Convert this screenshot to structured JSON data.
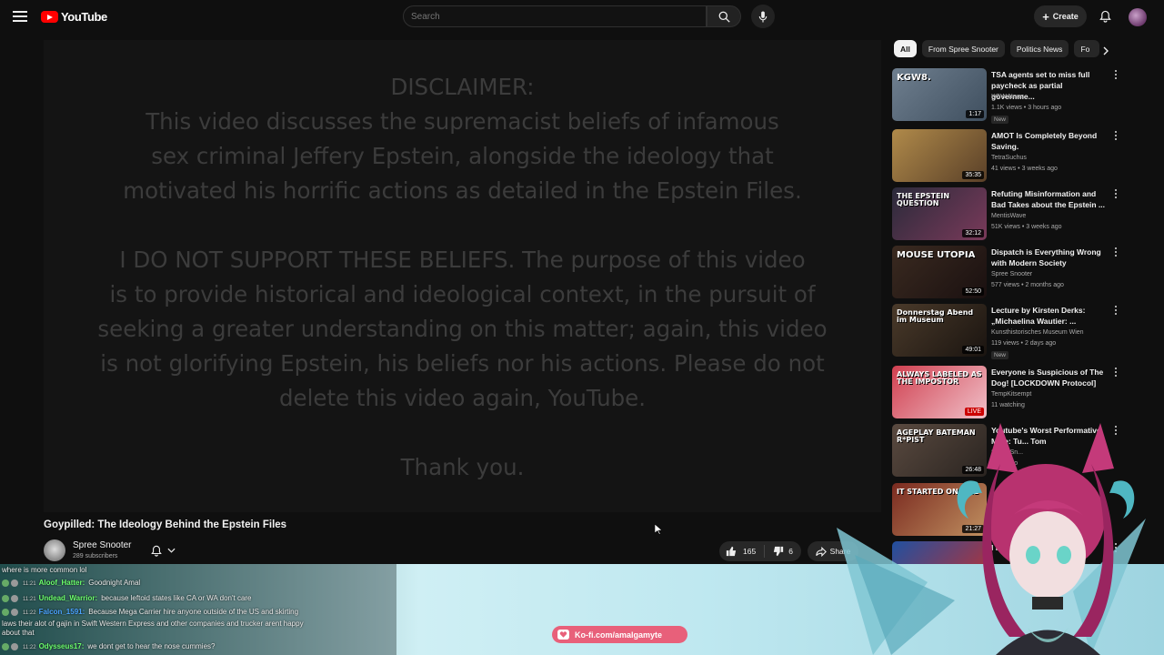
{
  "header": {
    "logo_text": "YouTube",
    "search_placeholder": "Search",
    "create_label": "Create"
  },
  "player": {
    "disclaimer_title": "DISCLAIMER:",
    "paragraph1": "This video discusses the supremacist beliefs of infamous\nsex criminal Jeffery Epstein, alongside the ideology that\nmotivated his horrific actions as detailed in the Epstein Files.",
    "paragraph2": "I DO NOT SUPPORT THESE BELIEFS. The purpose of this video\nis to provide historical and ideological context, in the pursuit of\nseeking a greater understanding on this matter; again, this video\nis not glorifying Epstein, his beliefs nor his actions. Please do not\ndelete this video again, YouTube.",
    "thanks": "Thank you."
  },
  "video": {
    "title": "Goypilled: The Ideology Behind the Epstein Files",
    "channel": "Spree Snooter",
    "subscribers": "289 subscribers",
    "likes": "165",
    "dislikes": "6",
    "share_label": "Share"
  },
  "chips": [
    "All",
    "From Spree Snooter",
    "Politics News",
    "Fo"
  ],
  "recommended": [
    {
      "title": "TSA agents set to miss full paycheck as partial governme...",
      "channel": "KGW News",
      "meta": "1.1K views • 3 hours ago",
      "duration": "1:17",
      "badge": "New",
      "thumb_text": "KGW8.",
      "colors": [
        "#6f7f8f",
        "#3f4f5f"
      ]
    },
    {
      "title": "AMOT Is Completely Beyond Saving.",
      "channel": "TetraSuchus",
      "meta": "41 views • 3 weeks ago",
      "duration": "35:35",
      "badge": "",
      "thumb_text": "",
      "colors": [
        "#b08a4a",
        "#5a4028"
      ]
    },
    {
      "title": "Refuting Misinformation and Bad Takes about the Epstein ...",
      "channel": "MentisWave",
      "meta": "51K views • 3 weeks ago",
      "duration": "32:12",
      "badge": "",
      "thumb_text": "THE EPSTEIN QUESTION",
      "colors": [
        "#2a2a3a",
        "#7a3a5a"
      ]
    },
    {
      "title": "Dispatch is Everything Wrong with Modern Society",
      "channel": "Spree Snooter",
      "meta": "577 views • 2 months ago",
      "duration": "52:50",
      "badge": "",
      "thumb_text": "MOUSE UTOPIA",
      "colors": [
        "#3a2a20",
        "#1a1010"
      ]
    },
    {
      "title": "Lecture by Kirsten Derks: „Michaelina Wautier: ...",
      "channel": "Kunsthistorisches Museum Wien",
      "meta": "119 views • 2 days ago",
      "duration": "49:01",
      "badge": "New",
      "thumb_text": "Donnerstag Abend im Museum",
      "colors": [
        "#4a3a2a",
        "#1a1410"
      ]
    },
    {
      "title": "Everyone is Suspicious of The Dog! [LOCKDOWN Protocol]",
      "channel": "TempKitsempt",
      "meta": "11 watching",
      "duration": "LIVE",
      "badge": "",
      "thumb_text": "ALWAYS LABELED AS THE IMPOSTOR",
      "colors": [
        "#d04050",
        "#f0c0c8"
      ]
    },
    {
      "title": "Youtube's Worst Performative Male: Tu... Tom",
      "channel": "Spree Sn...",
      "meta": "...nth ago",
      "duration": "26:48",
      "badge": "",
      "thumb_text": "AGEPLAY BATEMAN R*PIST",
      "colors": [
        "#5a4a40",
        "#2a2420"
      ]
    },
    {
      "title": "",
      "channel": "",
      "meta": "",
      "duration": "21:27",
      "badge": "",
      "thumb_text": "IT STARTED ON 9/11",
      "colors": [
        "#7a2a20",
        "#c09060"
      ]
    },
    {
      "title": "I Inve... Lady...",
      "channel": "",
      "meta": "",
      "duration": "",
      "badge": "",
      "thumb_text": "",
      "colors": [
        "#2050a0",
        "#c03030"
      ]
    }
  ],
  "chat": {
    "top_line": "where is more common lol",
    "messages": [
      {
        "time": "11:21",
        "user": "Aloof_Hatter:",
        "text": "Goodnight Amal"
      },
      {
        "time": "11:21",
        "user": "Undead_Warrior:",
        "text": "because leftoid states like CA or WA don't care"
      },
      {
        "time": "11:22",
        "user": "Falcon_1591:",
        "text": "Because Mega Carrier hire anyone outside of the US and skirting"
      },
      {
        "time": "",
        "user": "",
        "text": "laws their alot of gajin in Swift Western Express and other companies and trucker arent happy"
      },
      {
        "time": "",
        "user": "",
        "text": "about that"
      },
      {
        "time": "11:22",
        "user": "Odysseus17:",
        "text": "we dont get to hear the nose cummies?"
      }
    ]
  },
  "kofi_label": "Ko-fi.com/amalgamyte"
}
